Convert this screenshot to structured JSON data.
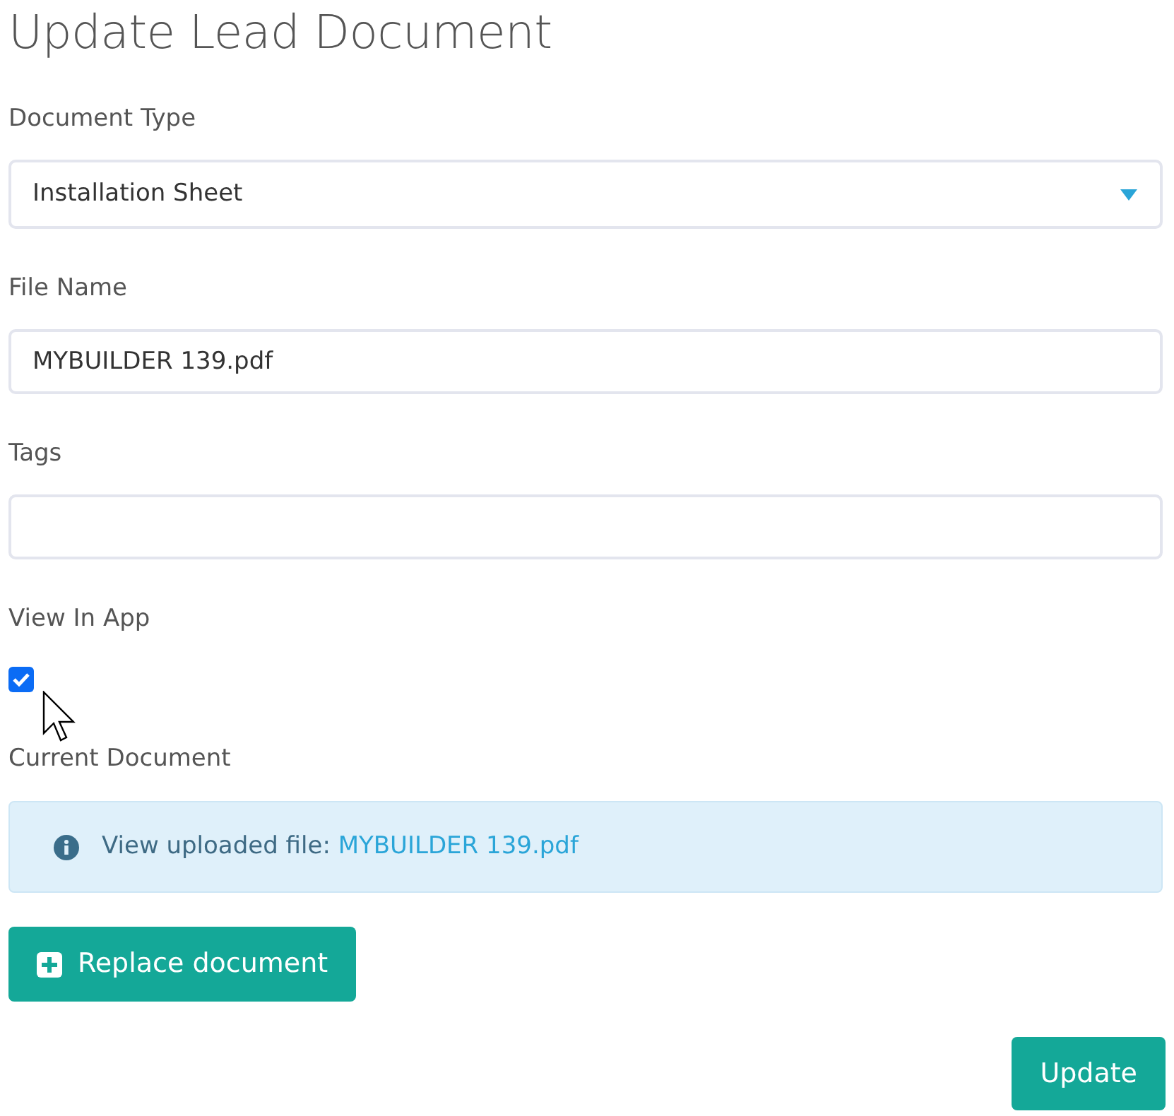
{
  "title": "Update Lead Document",
  "fields": [
    {
      "kind": "select",
      "label": "Document Type",
      "value": "Installation Sheet"
    },
    {
      "kind": "text",
      "label": "File Name",
      "value": "MYBUILDER 139.pdf"
    },
    {
      "kind": "text",
      "label": "Tags"
    },
    {
      "kind": "checkbox",
      "label": "View In App",
      "checked": true
    }
  ],
  "current_document": {
    "label": "Current Document",
    "text": "View uploaded file: ",
    "link": "MYBUILDER 139.pdf"
  },
  "replace_button": "Replace document",
  "submit_button": "Update"
}
